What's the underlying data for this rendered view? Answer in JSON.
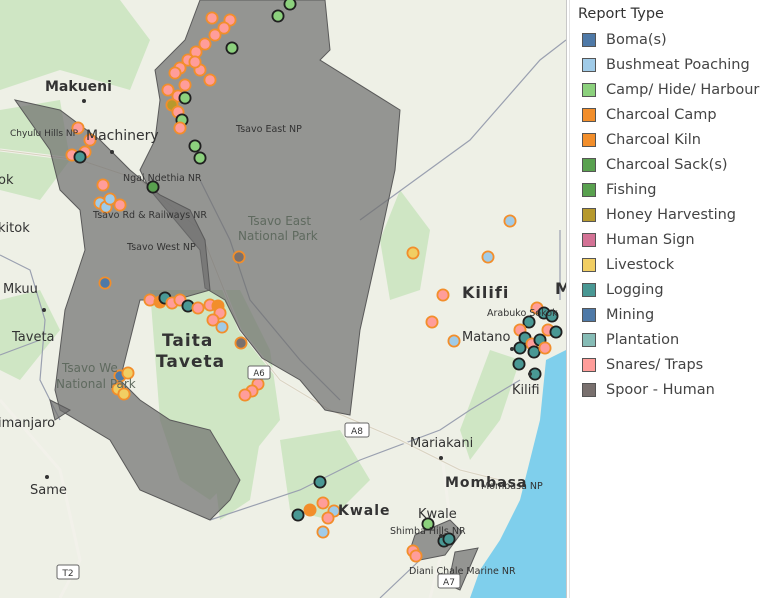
{
  "map": {
    "places": {
      "makueni": "Makueni",
      "chyulu": "Chyulu Hills NP",
      "machinery": "Machinery",
      "ok": "ok",
      "kitok": "kitok",
      "ngai_ndethia": "Ngai Ndethia NR",
      "tsavo_rd": "Tsavo Rd & Railways NR",
      "tsavo_west_np": "Tsavo West NP",
      "tsavo_east_np": "Tsavo East NP",
      "tsavo_east_park_1": "Tsavo East",
      "tsavo_east_park_2": "National Park",
      "tsavo_west_park_1": "Tsavo We",
      "tsavo_west_park_2": "National Park",
      "mkuu": "Mkuu",
      "taveta": "Taveta",
      "taita_1": "Taita",
      "taita_2": "Taveta",
      "imanjaro": "imanjaro",
      "same": "Same",
      "kilifi_region": "Kilifi",
      "kilifi_town": "Kilifi",
      "arabuko": "Arabuko Sokok",
      "matano": "Matano",
      "m_edge": "M",
      "mariakani": "Mariakani",
      "mombasa": "Mombasa",
      "mombasa_np": "Mombasa NP",
      "kwale_region": "Kwale",
      "kwale_town": "Kwale",
      "shimba": "Shimba Hills NR",
      "diani": "Diani Chale Marine NR"
    },
    "roads": {
      "a8": "A8",
      "a6": "A6",
      "t2": "T2",
      "a7": "A7"
    }
  },
  "legend": {
    "title": "Report Type",
    "items": [
      {
        "label": "Boma(s)",
        "color": "#4e79a7"
      },
      {
        "label": "Bushmeat Poaching",
        "color": "#a0cbe8"
      },
      {
        "label": "Camp/ Hide/ Harbour",
        "color": "#8cd17d"
      },
      {
        "label": "Charcoal Camp",
        "color": "#f28e2b"
      },
      {
        "label": "Charcoal Kiln",
        "color": "#f28e2b"
      },
      {
        "label": "Charcoal Sack(s)",
        "color": "#59a14f"
      },
      {
        "label": "Fishing",
        "color": "#59a14f"
      },
      {
        "label": "Honey Harvesting",
        "color": "#b6992d"
      },
      {
        "label": "Human Sign",
        "color": "#d37295"
      },
      {
        "label": "Livestock",
        "color": "#f1ce63"
      },
      {
        "label": "Logging",
        "color": "#499894"
      },
      {
        "label": "Mining",
        "color": "#4e79a7"
      },
      {
        "label": "Plantation",
        "color": "#86bcb6"
      },
      {
        "label": "Snares/ Traps",
        "color": "#ff9d9a"
      },
      {
        "label": "Spoor - Human",
        "color": "#79706e"
      }
    ]
  }
}
